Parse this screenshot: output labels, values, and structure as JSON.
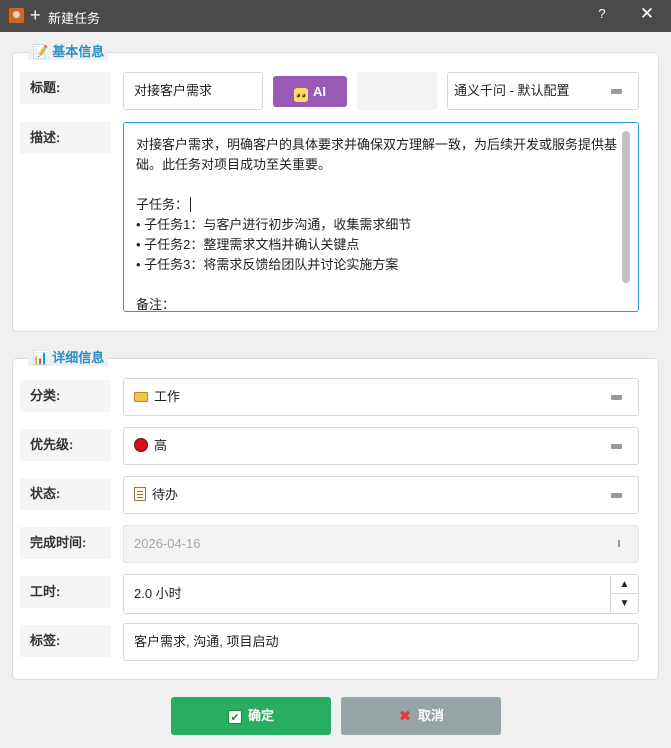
{
  "window": {
    "title": "新建任务",
    "help_label": "?",
    "close_label": "✕"
  },
  "basic_section": {
    "title": "基本信息",
    "icon": "memo-icon",
    "title_label": "标题:",
    "title_value": "对接客户需求",
    "ai_button_label": "AI",
    "model_select_value": "通义千问 - 默认配置",
    "description_label": "描述:",
    "description_lines": [
      "对接客户需求，明确客户的具体要求并确保双方理解一致，为后续开发或服务提供基",
      "础。此任务对项目成功至关重要。",
      "",
      "子任务：",
      "• 子任务1：与客户进行初步沟通，收集需求细节",
      "• 子任务2：整理需求文档并确认关键点",
      "• 子任务3：将需求反馈给团队并讨论实施方案",
      "",
      "备注："
    ]
  },
  "detail_section": {
    "title": "详细信息",
    "icon": "bar-chart-icon",
    "category_label": "分类:",
    "category_value": "工作",
    "priority_label": "优先级:",
    "priority_value": "高",
    "status_label": "状态:",
    "status_value": "待办",
    "due_label": "完成时间:",
    "due_value": "2026-04-16",
    "hours_label": "工时:",
    "hours_value": "2.0 小时",
    "tags_label": "标签:",
    "tags_value": "客户需求, 沟通, 项目启动"
  },
  "buttons": {
    "ok_label": "确定",
    "cancel_label": "取消"
  },
  "colors": {
    "accent": "#2a8ec9",
    "ai_button": "#9b59b6",
    "ok_button": "#27ae60",
    "cancel_button": "#95a5a6",
    "priority_high": "#d6101b"
  }
}
